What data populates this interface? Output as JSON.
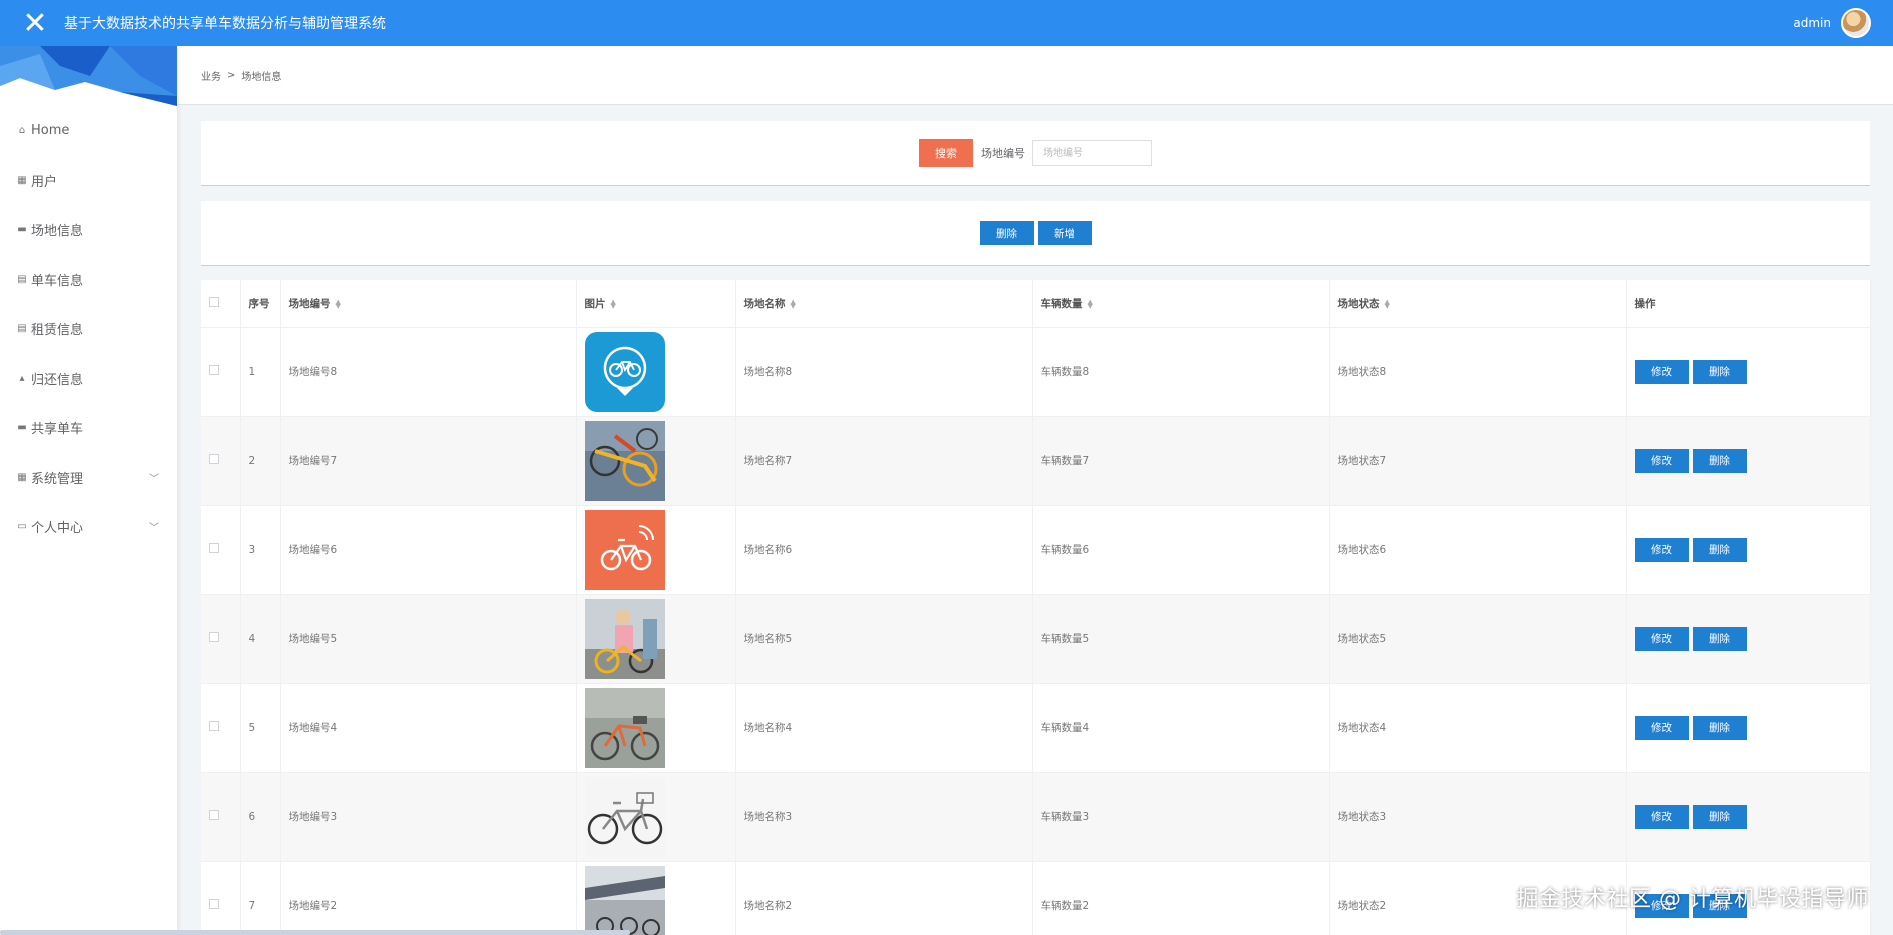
{
  "app": {
    "title": "基于大数据技术的共享单车数据分析与辅助管理系统",
    "user": "admin"
  },
  "sidebar": {
    "items": [
      {
        "label": "Home",
        "icon": "home-icon"
      },
      {
        "label": "用户",
        "icon": "grid-icon"
      },
      {
        "label": "场地信息",
        "icon": "briefcase-icon"
      },
      {
        "label": "单车信息",
        "icon": "clipboard-icon"
      },
      {
        "label": "租赁信息",
        "icon": "document-icon"
      },
      {
        "label": "归还信息",
        "icon": "thumb-icon"
      },
      {
        "label": "共享单车",
        "icon": "monitor-icon"
      },
      {
        "label": "系统管理",
        "icon": "grid-icon",
        "expandable": true
      },
      {
        "label": "个人中心",
        "icon": "card-icon",
        "expandable": true
      }
    ]
  },
  "breadcrumb": {
    "items": [
      "业务",
      "场地信息"
    ],
    "separator": ">"
  },
  "search": {
    "button_label": "搜索",
    "field_label": "场地编号",
    "placeholder": "场地编号",
    "value": ""
  },
  "actions": {
    "delete_label": "删除",
    "add_label": "新增"
  },
  "table": {
    "columns": [
      "序号",
      "场地编号",
      "图片",
      "场地名称",
      "车辆数量",
      "场地状态",
      "操作"
    ],
    "edit_label": "修改",
    "delete_label": "删除",
    "rows": [
      {
        "index": "1",
        "code": "场地编号8",
        "name": "场地名称8",
        "count": "车辆数量8",
        "status": "场地状态8",
        "image": "blue-bike-logo"
      },
      {
        "index": "2",
        "code": "场地编号7",
        "name": "场地名称7",
        "count": "车辆数量7",
        "status": "场地状态7",
        "image": "parked-bikes-photo"
      },
      {
        "index": "3",
        "code": "场地编号6",
        "name": "场地名称6",
        "count": "车辆数量6",
        "status": "场地状态6",
        "image": "orange-bike-logo"
      },
      {
        "index": "4",
        "code": "场地编号5",
        "name": "场地名称5",
        "count": "车辆数量5",
        "status": "场地状态5",
        "image": "rider-photo"
      },
      {
        "index": "5",
        "code": "场地编号4",
        "name": "场地名称4",
        "count": "车辆数量4",
        "status": "场地状态4",
        "image": "bike-street-photo"
      },
      {
        "index": "6",
        "code": "场地编号3",
        "name": "场地名称3",
        "count": "车辆数量3",
        "status": "场地状态3",
        "image": "white-bike-photo"
      },
      {
        "index": "7",
        "code": "场地编号2",
        "name": "场地名称2",
        "count": "车辆数量2",
        "status": "场地状态2",
        "image": "bike-shelter-photo"
      }
    ]
  },
  "watermark": "掘金技术社区 @ 计算机毕设指导师",
  "colors": {
    "topbar": "#2d8cf0",
    "search_button": "#f06f4e",
    "action_button": "#1f7fd1"
  }
}
